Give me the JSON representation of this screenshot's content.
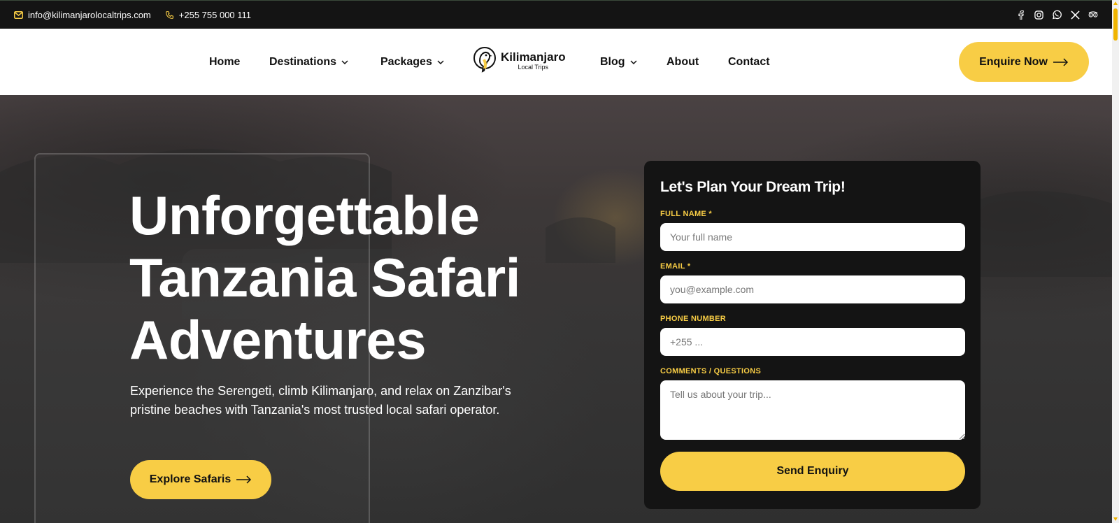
{
  "topbar": {
    "email": "info@kilimanjarolocaltrips.com",
    "phone": "+255 755 000 111",
    "socials": [
      "facebook-icon",
      "instagram-icon",
      "whatsapp-icon",
      "x-icon",
      "tripadvisor-icon"
    ]
  },
  "nav": {
    "home": "Home",
    "destinations": "Destinations",
    "packages": "Packages",
    "blog": "Blog",
    "about": "About",
    "contact": "Contact"
  },
  "logo": {
    "title": "Kilimanjaro",
    "subtitle": "Local Trips"
  },
  "header": {
    "cta": "Enquire Now"
  },
  "hero": {
    "title_line1": "Unforgettable",
    "title_line2": "Tanzania Safari",
    "title_line3": "Adventures",
    "subtitle": "Experience the Serengeti, climb Kilimanjaro, and relax on Zanzibar's pristine beaches with Tanzania's most trusted local safari operator.",
    "cta": "Explore Safaris"
  },
  "form": {
    "title": "Let's Plan Your Dream Trip!",
    "name_label": "FULL NAME *",
    "name_placeholder": "Your full name",
    "email_label": "EMAIL *",
    "email_placeholder": "you@example.com",
    "phone_label": "PHONE NUMBER",
    "phone_placeholder": "+255 ...",
    "comments_label": "COMMENTS / QUESTIONS",
    "comments_placeholder": "Tell us about your trip...",
    "submit": "Send Enquiry"
  },
  "colors": {
    "accent": "#f8cd45",
    "topbar": "#141414",
    "form_bg": "#141414"
  }
}
